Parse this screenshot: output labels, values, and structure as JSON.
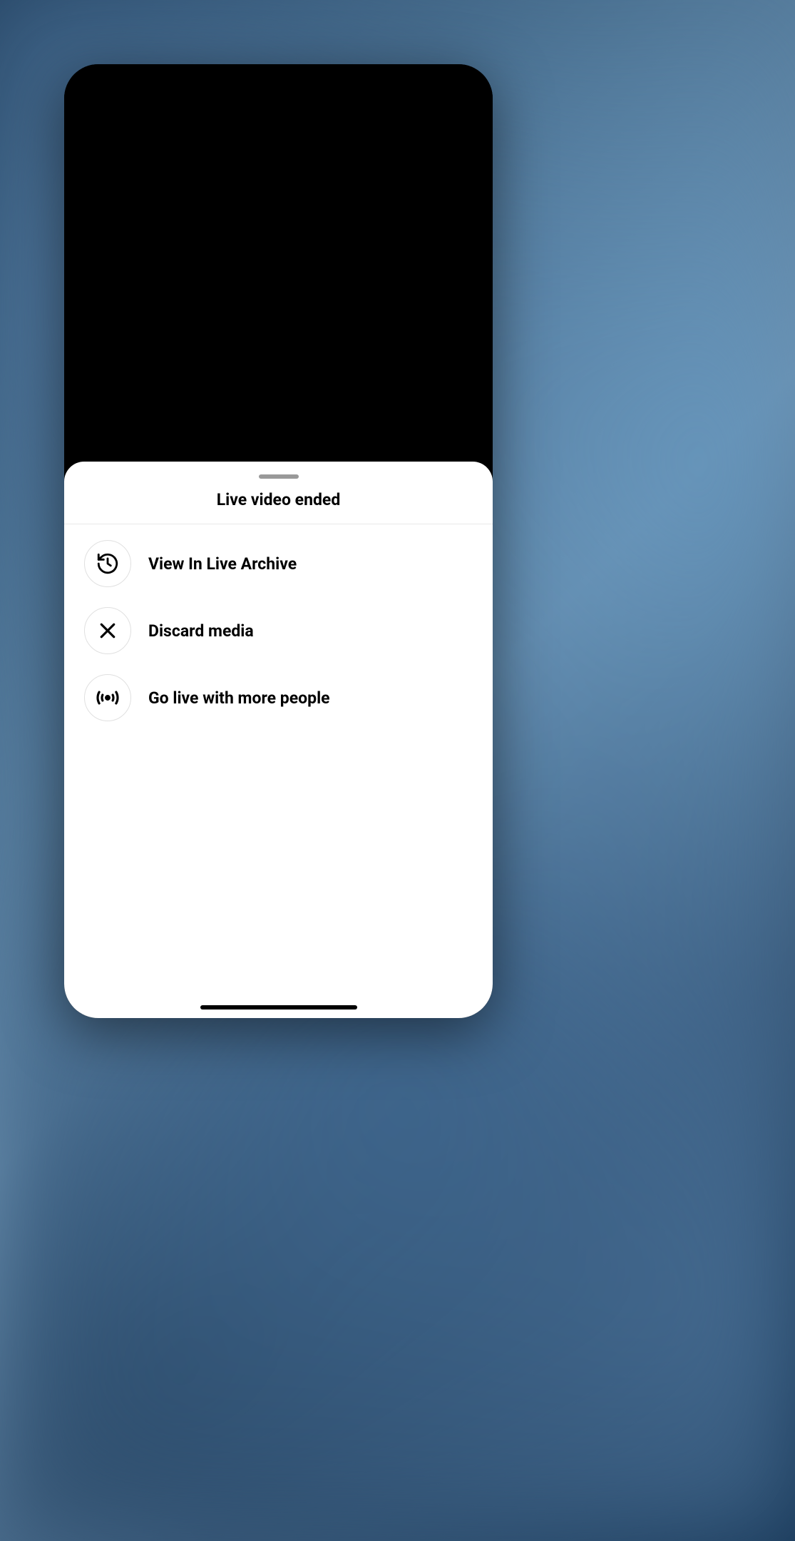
{
  "sheet": {
    "title": "Live video ended",
    "options": [
      {
        "icon": "history-icon",
        "label": "View In Live Archive"
      },
      {
        "icon": "close-icon",
        "label": "Discard media"
      },
      {
        "icon": "broadcast-icon",
        "label": "Go live with more people"
      }
    ]
  }
}
